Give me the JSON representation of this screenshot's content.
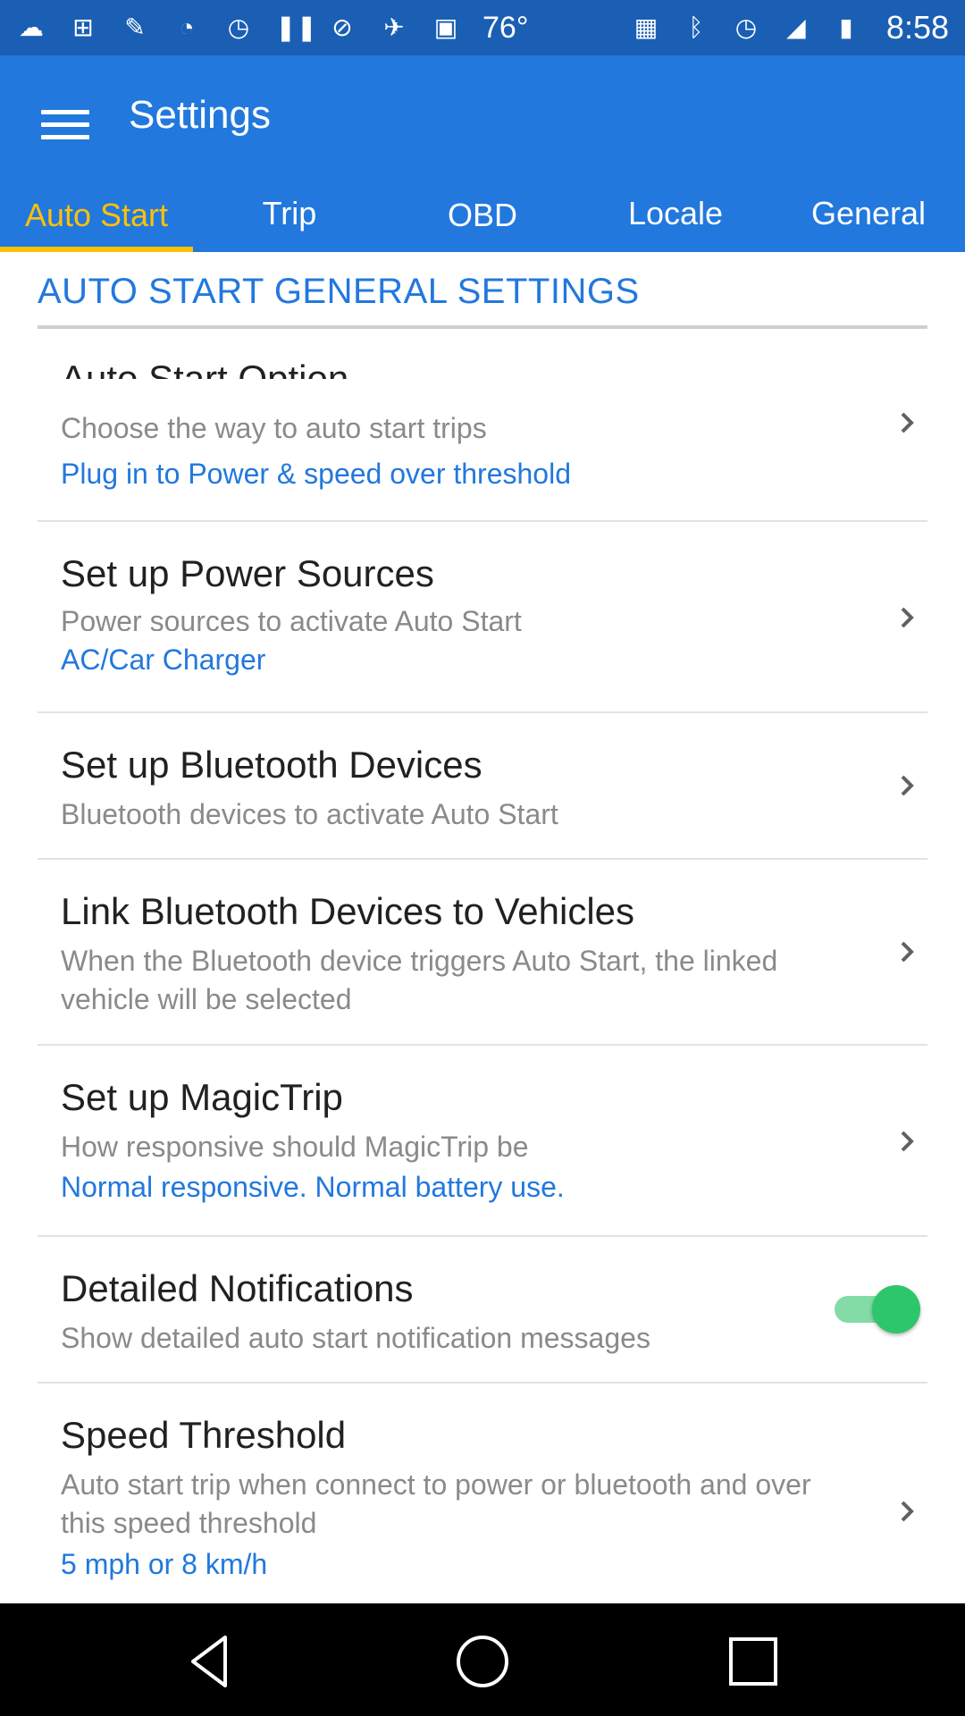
{
  "status_bar": {
    "temperature": "76°",
    "time": "8:58",
    "left_icons": [
      "weather-icon",
      "add-icon",
      "wrench-icon",
      "timer-icon",
      "alarm-icon",
      "pause-icon",
      "block-icon",
      "satellite-icon",
      "lock-icon"
    ],
    "right_icons": [
      "photo-icon",
      "bluetooth-icon",
      "alarm-icon",
      "wifi-icon",
      "battery-icon"
    ]
  },
  "app_bar": {
    "title": "Settings",
    "menu_icon": "hamburger-menu-icon"
  },
  "tabs": [
    {
      "label": "Auto Start",
      "active": true
    },
    {
      "label": "Trip",
      "active": false
    },
    {
      "label": "OBD",
      "active": false
    },
    {
      "label": "Locale",
      "active": false
    },
    {
      "label": "General",
      "active": false
    }
  ],
  "colors": {
    "app_bar": "#2278dd",
    "status_bar": "#1a5fb4",
    "accent": "#ffc107",
    "link": "#2278dd",
    "toggle_on": "#2ec66b"
  },
  "section": {
    "title": "AUTO START GENERAL SETTINGS"
  },
  "preferences": [
    {
      "title": "Auto Start Option",
      "summary": "Choose the way to auto start trips",
      "value": "Plug in to Power & speed over threshold",
      "control": "chevron"
    },
    {
      "title": "Set up Power Sources",
      "summary": "Power sources to activate Auto Start",
      "value": "AC/Car Charger",
      "control": "chevron"
    },
    {
      "title": "Set up Bluetooth Devices",
      "summary": "Bluetooth devices to activate Auto Start",
      "control": "chevron"
    },
    {
      "title": "Link Bluetooth Devices to Vehicles",
      "summary": "When the Bluetooth device triggers Auto Start, the linked vehicle will be selected",
      "control": "chevron"
    },
    {
      "title": "Set up MagicTrip",
      "summary": "How responsive should MagicTrip be",
      "value": "Normal responsive. Normal battery use.",
      "control": "chevron"
    },
    {
      "title": "Detailed Notifications",
      "summary": "Show detailed auto start notification messages",
      "control": "toggle",
      "toggle_on": true
    },
    {
      "title": "Speed Threshold",
      "summary": "Auto start trip when connect to power or bluetooth and over this speed threshold",
      "value": "5 mph or 8 km/h",
      "control": "chevron"
    }
  ],
  "nav_bar": {
    "buttons": [
      "back-icon",
      "home-icon",
      "recents-icon"
    ]
  }
}
